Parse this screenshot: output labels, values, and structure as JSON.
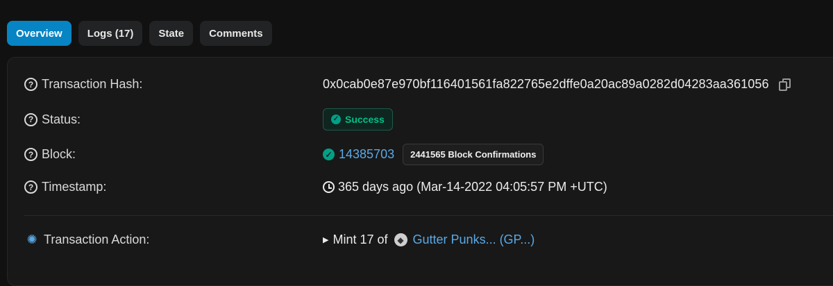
{
  "tabs": [
    {
      "label": "Overview",
      "active": true
    },
    {
      "label": "Logs (17)",
      "active": false
    },
    {
      "label": "State",
      "active": false
    },
    {
      "label": "Comments",
      "active": false
    }
  ],
  "rows": {
    "hash": {
      "label": "Transaction Hash:",
      "value": "0x0cab0e87e970bf116401561fa822765e2dffe0a20ac89a0282d04283aa361056"
    },
    "status": {
      "label": "Status:",
      "value": "Success"
    },
    "block": {
      "label": "Block:",
      "number": "14385703",
      "confirmations": "2441565 Block Confirmations"
    },
    "timestamp": {
      "label": "Timestamp:",
      "value": "365 days ago (Mar-14-2022 04:05:57 PM +UTC)"
    },
    "action": {
      "label": "Transaction Action:",
      "verb": "Mint 17 of",
      "token": "Gutter Punks... (GP...)"
    }
  },
  "icons": {
    "help": "question-circle-icon",
    "copy": "copy-icon",
    "success": "check-circle-icon",
    "clock": "clock-icon",
    "bulb": "lightbulb-icon",
    "eth": "ethereum-icon"
  },
  "colors": {
    "accent": "#0784c3",
    "link": "#5aa9e6",
    "success": "#00c087"
  }
}
